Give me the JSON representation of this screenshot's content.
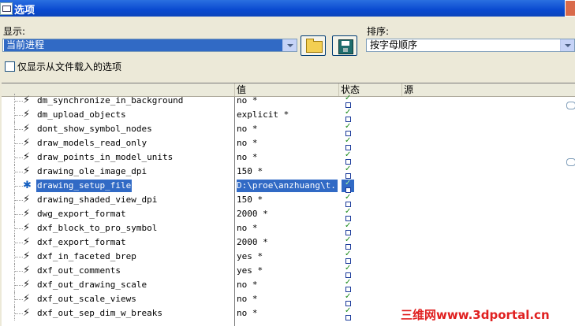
{
  "window": {
    "title": "选项"
  },
  "display": {
    "label": "显示:",
    "value": "当前进程"
  },
  "sort": {
    "label": "排序:",
    "value": "按字母顺序"
  },
  "checkbox": {
    "label": "仅显示从文件载入的选项",
    "checked": false
  },
  "columns": {
    "value": "值",
    "status": "状态",
    "source": "源"
  },
  "rows": [
    {
      "name": "dm_synchronize_in_background",
      "value": "no *"
    },
    {
      "name": "dm_upload_objects",
      "value": "explicit *"
    },
    {
      "name": "dont_show_symbol_nodes",
      "value": "no *"
    },
    {
      "name": "draw_models_read_only",
      "value": "no *"
    },
    {
      "name": "draw_points_in_model_units",
      "value": "no *"
    },
    {
      "name": "drawing_ole_image_dpi",
      "value": "150 *"
    },
    {
      "name": "drawing_setup_file",
      "value": "D:\\proe\\anzhuang\\t...",
      "selected": true
    },
    {
      "name": "drawing_shaded_view_dpi",
      "value": "150 *"
    },
    {
      "name": "dwg_export_format",
      "value": "2000 *"
    },
    {
      "name": "dxf_block_to_pro_symbol",
      "value": "no *"
    },
    {
      "name": "dxf_export_format",
      "value": "2000 *"
    },
    {
      "name": "dxf_in_faceted_brep",
      "value": "yes *"
    },
    {
      "name": "dxf_out_comments",
      "value": "yes *"
    },
    {
      "name": "dxf_out_drawing_scale",
      "value": "no *"
    },
    {
      "name": "dxf_out_scale_views",
      "value": "no *"
    },
    {
      "name": "dxf_out_sep_dim_w_breaks",
      "value": "no *"
    }
  ],
  "watermark": "三维网www.3dportal.cn"
}
